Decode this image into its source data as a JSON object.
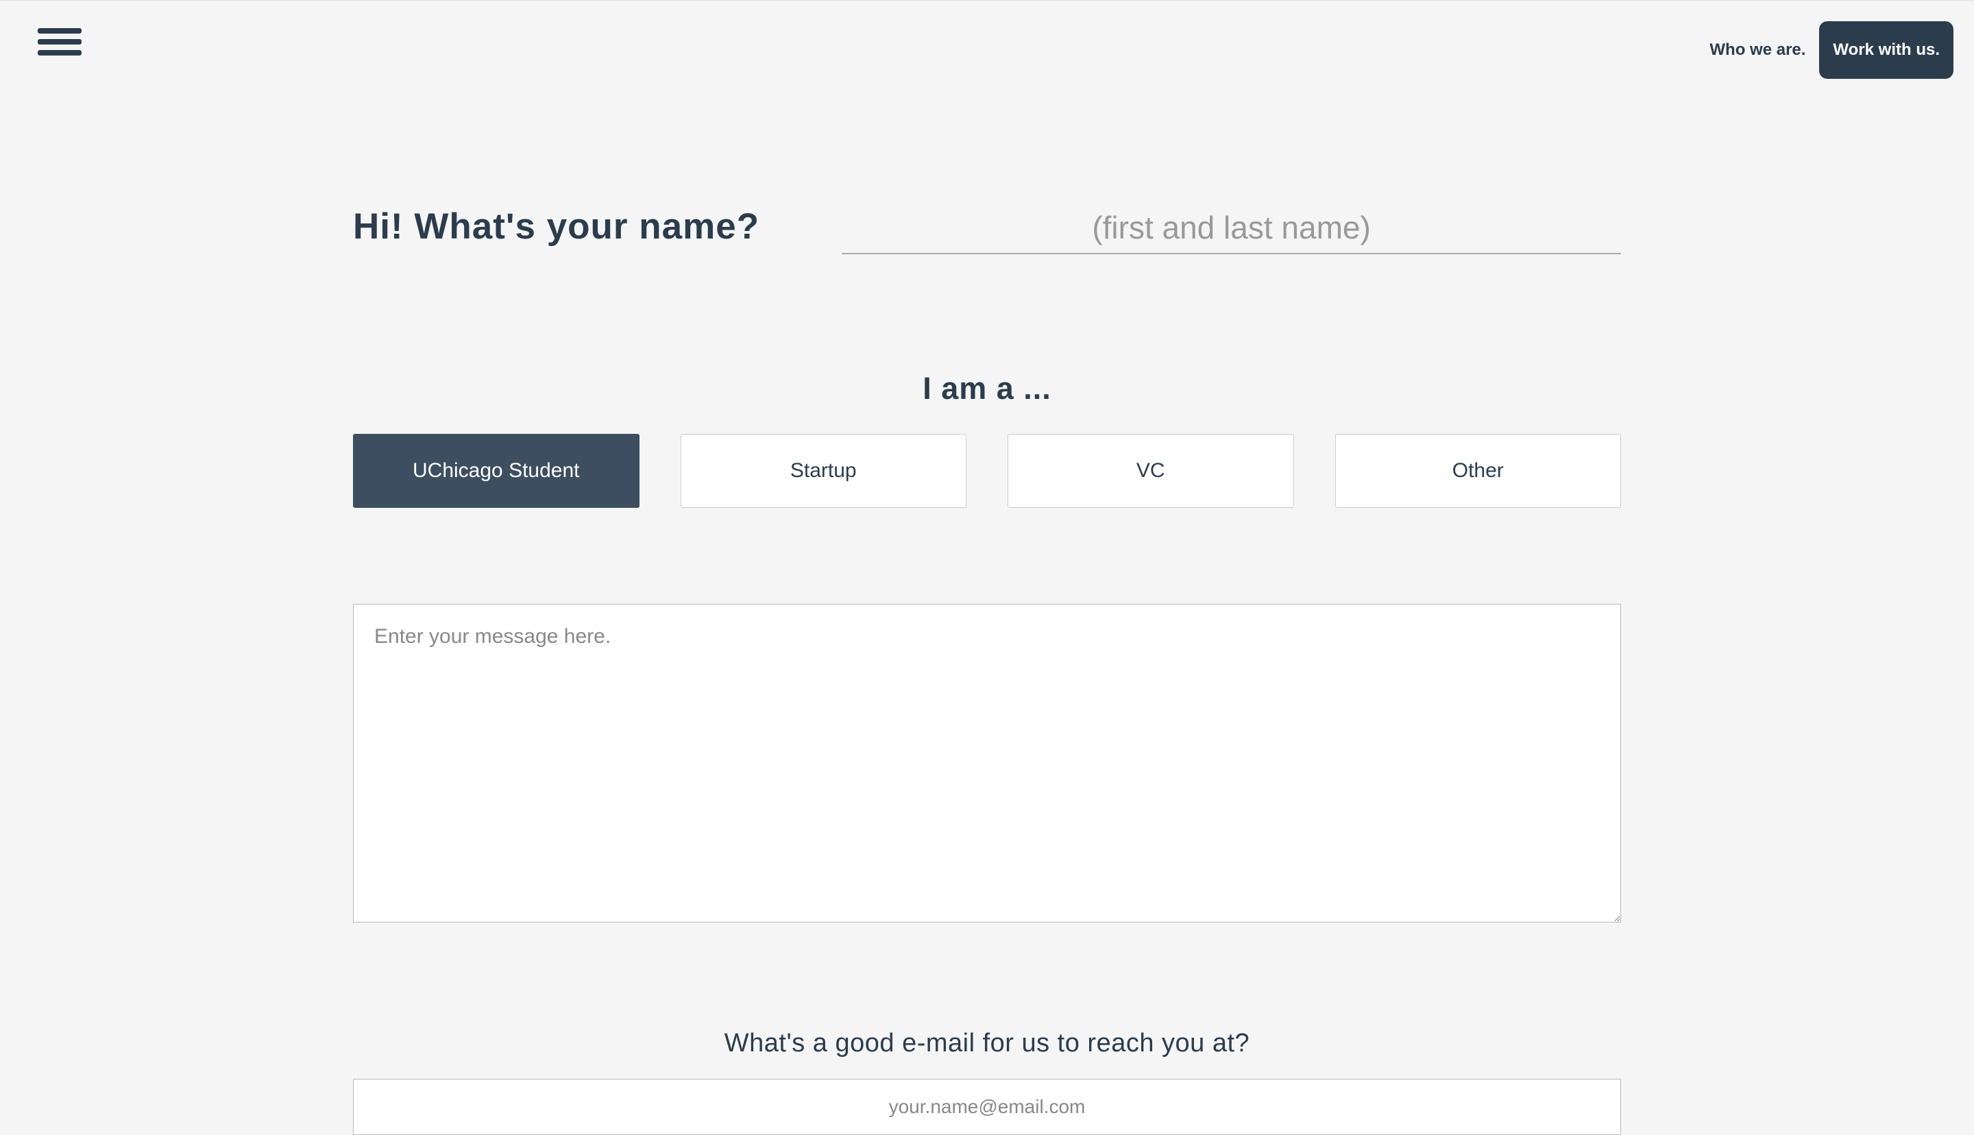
{
  "nav": {
    "who_we_are": "Who we are.",
    "work_with_us": "Work with us."
  },
  "form": {
    "name_label": "Hi! What's your name?",
    "name_placeholder": "(first and last name)",
    "role_label": "I am a ...",
    "roles": [
      "UChicago Student",
      "Startup",
      "VC",
      "Other"
    ],
    "message_placeholder": "Enter your message here.",
    "email_label": "What's a good e-mail for us to reach you at?",
    "email_placeholder": "your.name@email.com"
  }
}
